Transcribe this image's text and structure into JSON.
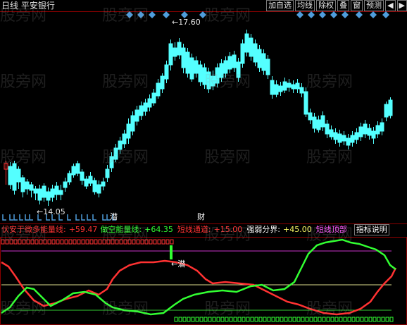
{
  "window": {
    "title": "日线 平安银行"
  },
  "toolbar": {
    "buttons": [
      {
        "label": "加自选"
      },
      {
        "label": "均线"
      },
      {
        "label": "除权"
      },
      {
        "label": "叠"
      },
      {
        "label": "窗"
      },
      {
        "label": "预测"
      },
      {
        "label": "◀"
      },
      {
        "label": "▶"
      }
    ]
  },
  "price_chart": {
    "high_marker": "17.60",
    "low_marker": "14.05",
    "event_label_1": "潜",
    "event_label_2": "财",
    "colors": {
      "up": "#ff3232",
      "down": "#54ffff",
      "marker": "#4f9ddc"
    }
  },
  "indicator": {
    "legend": [
      {
        "text": "伏安于微多能量线:",
        "color": "#ff3232"
      },
      {
        "text": "+59.47",
        "color": "#ff3232"
      },
      {
        "text": "做空能量线:",
        "color": "#32ff32"
      },
      {
        "text": "+64.35",
        "color": "#32ff32"
      },
      {
        "text": "短线通道:",
        "color": "#ff3232"
      },
      {
        "text": "+15.00",
        "color": "#ff3232"
      },
      {
        "text": "强弱分界:",
        "color": "#ffffff"
      },
      {
        "text": "+45.00",
        "color": "#ffff66"
      },
      {
        "text": "短线顶部",
        "color": "#ff55ff"
      },
      {
        "text": "指标说明",
        "color": "#ffffff"
      }
    ],
    "signal_label": "潜",
    "colors": {
      "bull": "#ff3232",
      "bear": "#32ff32",
      "top_line": "#c832c8",
      "mid_line": "#dcdc8c",
      "low_line": "#32c832"
    }
  },
  "watermark_text": "股旁网"
}
